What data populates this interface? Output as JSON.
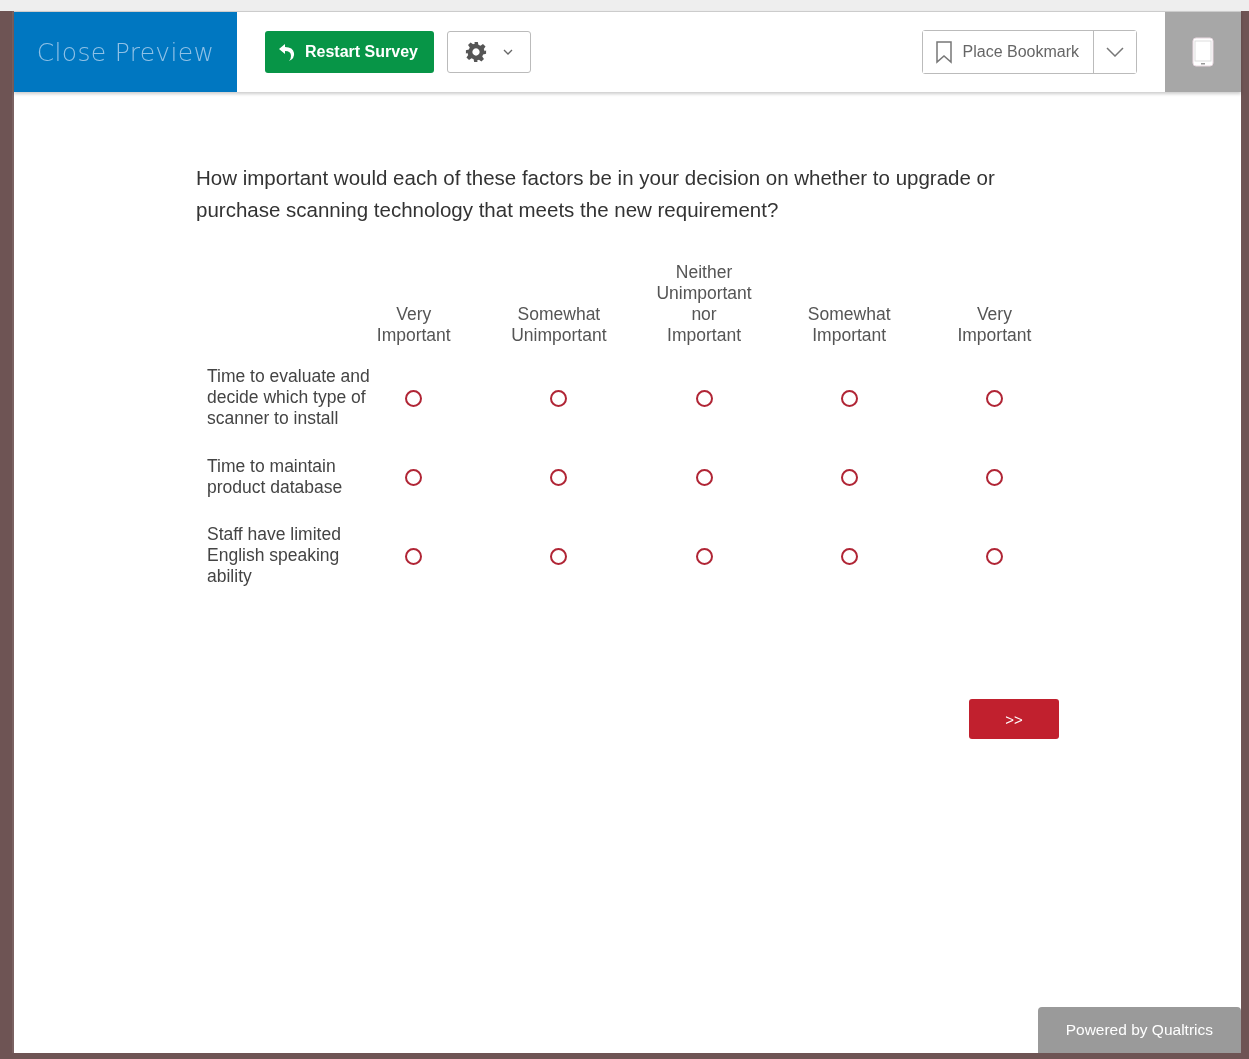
{
  "toolbar": {
    "close_preview": "Close Preview",
    "restart_button": "Restart Survey",
    "bookmark_button": "Place Bookmark"
  },
  "question": {
    "text": "How important would each of these factors be in your decision on whether to upgrade or purchase scanning technology that meets the new requirement?",
    "columns": [
      "Very Important",
      "Somewhat Unimportant",
      "Neither Unimportant nor Important",
      "Somewhat Important",
      "Very Important"
    ],
    "rows": [
      {
        "label": "Time to evaluate and decide which type of scanner to install",
        "options": [
          {
            "selected": false
          },
          {
            "selected": false
          },
          {
            "selected": false
          },
          {
            "selected": false
          },
          {
            "selected": false
          }
        ]
      },
      {
        "label": "Time to maintain product database",
        "options": [
          {
            "selected": false
          },
          {
            "selected": false
          },
          {
            "selected": false
          },
          {
            "selected": false
          },
          {
            "selected": false
          }
        ]
      },
      {
        "label": "Staff have limited English speaking ability",
        "options": [
          {
            "selected": false
          },
          {
            "selected": false
          },
          {
            "selected": false
          },
          {
            "selected": false
          },
          {
            "selected": false
          }
        ]
      }
    ]
  },
  "next_button": ">>",
  "footer": "Powered by Qualtrics"
}
